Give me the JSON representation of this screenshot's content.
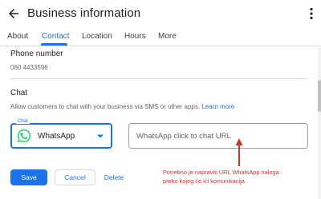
{
  "header": {
    "title": "Business information"
  },
  "tabs": [
    {
      "label": "About"
    },
    {
      "label": "Contact"
    },
    {
      "label": "Location"
    },
    {
      "label": "Hours"
    },
    {
      "label": "More"
    }
  ],
  "active_tab": "Contact",
  "phone": {
    "label": "Phone number",
    "value": "060 4433596"
  },
  "chat": {
    "heading": "Chat",
    "description": "Allow customers to chat with your business via SMS or other apps.",
    "learn_more": "Learn more",
    "select_label": "Chat",
    "selected_app": "WhatsApp",
    "url_placeholder": "WhatsApp click to chat URL"
  },
  "actions": {
    "save": "Save",
    "cancel": "Cancel",
    "delete": "Delete"
  },
  "annotation": {
    "line1": "Potrebno je napraviti URL WhatsApp naloga",
    "line2": "preko kojeg će ići komunikacija"
  },
  "colors": {
    "accent": "#1a73e8",
    "whatsapp": "#25d366",
    "annotation": "#d93025"
  }
}
